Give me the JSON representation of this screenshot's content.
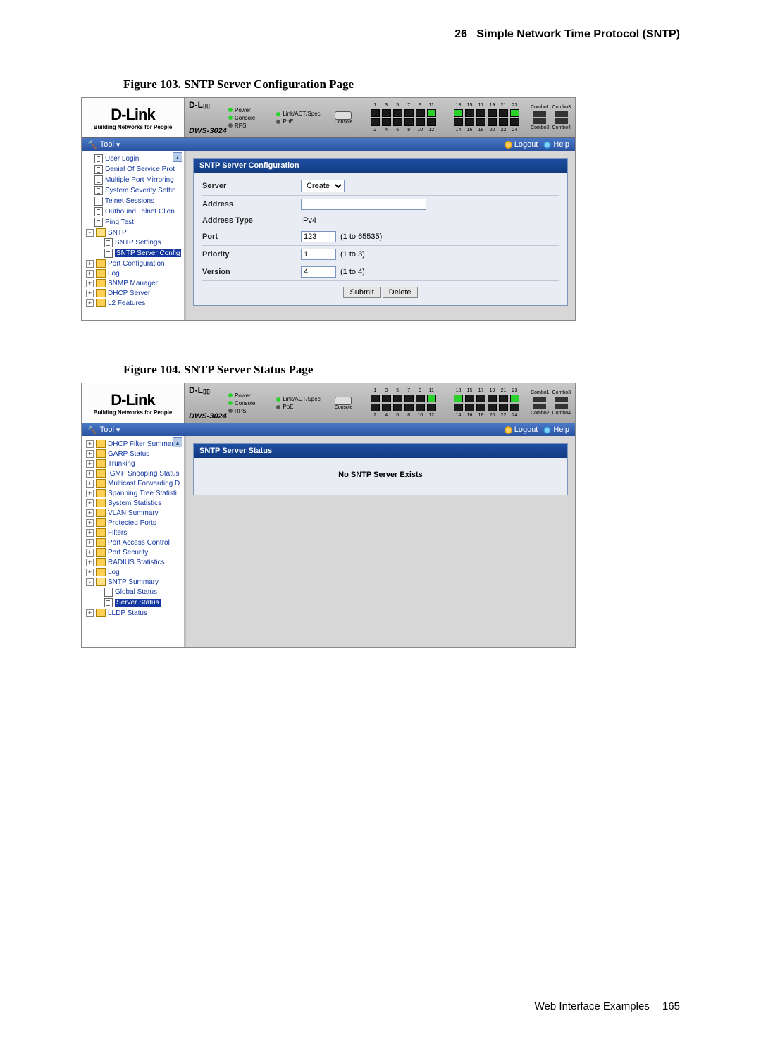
{
  "header": {
    "chapter_num": "26",
    "chapter_title": "Simple Network Time Protocol (SNTP)"
  },
  "footer": {
    "text": "Web Interface Examples",
    "page_num": "165"
  },
  "logo": {
    "brand": "D-Link",
    "tagline": "Building Networks for People",
    "model": "DWS-3024"
  },
  "leds": {
    "power": "Power",
    "console": "Console",
    "rps": "RPS",
    "linkact": "Link/ACT/Spec",
    "poe": "PoE"
  },
  "port_labels": {
    "top": [
      "1",
      "3",
      "5",
      "7",
      "9",
      "11",
      "13",
      "15",
      "17",
      "19",
      "21",
      "23"
    ],
    "bot": [
      "2",
      "4",
      "6",
      "8",
      "10",
      "12",
      "14",
      "16",
      "18",
      "20",
      "22",
      "24"
    ],
    "console": "Console",
    "combo": [
      "Combo1",
      "Combo2",
      "Combo3",
      "Combo4"
    ]
  },
  "toolbar": {
    "tool": "Tool",
    "logout": "Logout",
    "help": "Help"
  },
  "fig103": {
    "label": "Figure 103.",
    "title": "SNTP Server Configuration Page",
    "panel_title": "SNTP Server Configuration",
    "nav": [
      {
        "lbl": "User Login",
        "ico": "page",
        "ind": 1
      },
      {
        "lbl": "Denial Of Service Prot",
        "ico": "page",
        "ind": 1
      },
      {
        "lbl": "Multiple Port Mirroring",
        "ico": "page",
        "ind": 1
      },
      {
        "lbl": "System Severity Settin",
        "ico": "page",
        "ind": 1
      },
      {
        "lbl": "Telnet Sessions",
        "ico": "page",
        "ind": 1
      },
      {
        "lbl": "Outbound Telnet Clien",
        "ico": "page",
        "ind": 1
      },
      {
        "lbl": "Ping Test",
        "ico": "page",
        "ind": 1
      },
      {
        "lbl": "SNTP",
        "ico": "folder-open",
        "pm": "-",
        "ind": 0
      },
      {
        "lbl": "SNTP Settings",
        "ico": "page",
        "ind": 2
      },
      {
        "lbl": "SNTP Server Config",
        "ico": "page",
        "ind": 2,
        "sel": true
      },
      {
        "lbl": "Port Configuration",
        "ico": "folder",
        "pm": "+",
        "ind": 0
      },
      {
        "lbl": "Log",
        "ico": "folder",
        "pm": "+",
        "ind": 0
      },
      {
        "lbl": "SNMP Manager",
        "ico": "folder",
        "pm": "+",
        "ind": 0
      },
      {
        "lbl": "DHCP Server",
        "ico": "folder",
        "pm": "+",
        "ind": 0
      },
      {
        "lbl": "L2 Features",
        "ico": "folder",
        "pm": "+",
        "ind": -1
      }
    ],
    "form": {
      "server_label": "Server",
      "server_value": "Create",
      "address_label": "Address",
      "address_value": "",
      "addrtype_label": "Address Type",
      "addrtype_value": "IPv4",
      "port_label": "Port",
      "port_value": "123",
      "port_hint": "(1 to 65535)",
      "priority_label": "Priority",
      "priority_value": "1",
      "priority_hint": "(1 to 3)",
      "version_label": "Version",
      "version_value": "4",
      "version_hint": "(1 to 4)",
      "submit": "Submit",
      "delete": "Delete"
    }
  },
  "fig104": {
    "label": "Figure 104.",
    "title": "SNTP Server Status Page",
    "panel_title": "SNTP Server Status",
    "status_msg": "No SNTP Server Exists",
    "nav": [
      {
        "lbl": "DHCP Filter Summary",
        "ico": "folder",
        "pm": "+",
        "ind": 0
      },
      {
        "lbl": "GARP Status",
        "ico": "folder",
        "pm": "+",
        "ind": 0
      },
      {
        "lbl": "Trunking",
        "ico": "folder",
        "pm": "+",
        "ind": 0
      },
      {
        "lbl": "IGMP Snooping Status",
        "ico": "folder",
        "pm": "+",
        "ind": 0
      },
      {
        "lbl": "Multicast Forwarding D",
        "ico": "folder",
        "pm": "+",
        "ind": 0
      },
      {
        "lbl": "Spanning Tree Statisti",
        "ico": "folder",
        "pm": "+",
        "ind": 0
      },
      {
        "lbl": "System Statistics",
        "ico": "folder",
        "pm": "+",
        "ind": 0
      },
      {
        "lbl": "VLAN Summary",
        "ico": "folder",
        "pm": "+",
        "ind": 0
      },
      {
        "lbl": "Protected Ports",
        "ico": "folder",
        "pm": "+",
        "ind": 0
      },
      {
        "lbl": "Filters",
        "ico": "folder",
        "pm": "+",
        "ind": 0
      },
      {
        "lbl": "Port Access Control",
        "ico": "folder",
        "pm": "+",
        "ind": 0
      },
      {
        "lbl": "Port Security",
        "ico": "folder",
        "pm": "+",
        "ind": 0
      },
      {
        "lbl": "RADIUS Statistics",
        "ico": "folder",
        "pm": "+",
        "ind": 0
      },
      {
        "lbl": "Log",
        "ico": "folder",
        "pm": "+",
        "ind": 0
      },
      {
        "lbl": "SNTP Summary",
        "ico": "folder-open",
        "pm": "-",
        "ind": 0
      },
      {
        "lbl": "Global Status",
        "ico": "page",
        "ind": 2
      },
      {
        "lbl": "Server Status",
        "ico": "page",
        "ind": 2,
        "sel": true
      },
      {
        "lbl": "LLDP Status",
        "ico": "folder",
        "pm": "+",
        "ind": 0
      }
    ]
  }
}
